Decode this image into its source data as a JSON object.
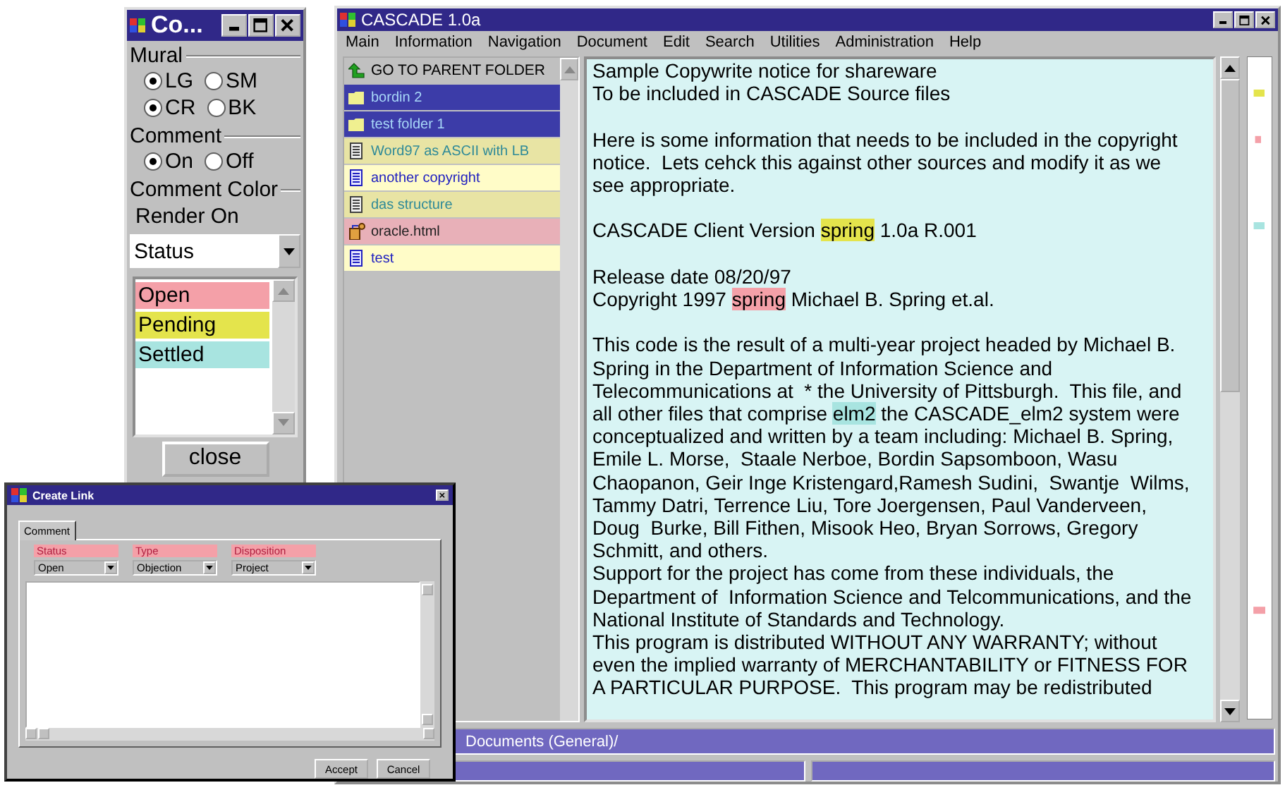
{
  "settings_window": {
    "title": "Co...",
    "mural": {
      "label": "Mural",
      "rows": [
        [
          {
            "label": "LG",
            "selected": true
          },
          {
            "label": "SM",
            "selected": false
          }
        ],
        [
          {
            "label": "CR",
            "selected": true
          },
          {
            "label": "BK",
            "selected": false
          }
        ]
      ]
    },
    "comment": {
      "label": "Comment",
      "options": [
        {
          "label": "On",
          "selected": true
        },
        {
          "label": "Off",
          "selected": false
        }
      ]
    },
    "comment_color_label": "Comment Color",
    "render_on": {
      "label": "Render On",
      "value": "Status"
    },
    "legend": [
      {
        "label": "Open",
        "color": "#f4a0a8"
      },
      {
        "label": "Pending",
        "color": "#e4e44c"
      },
      {
        "label": "Settled",
        "color": "#a8e4e0"
      }
    ],
    "close_button": "close"
  },
  "main_window": {
    "title": "CASCADE 1.0a",
    "menu": [
      "Main",
      "Information",
      "Navigation",
      "Document",
      "Edit",
      "Search",
      "Utilities",
      "Administration",
      "Help"
    ],
    "folder_pane": {
      "parent_link": "GO TO PARENT FOLDER",
      "items": [
        {
          "name": "bordin 2",
          "kind": "folder",
          "color": "#3c3ca8"
        },
        {
          "name": "test folder 1",
          "kind": "folder",
          "color": "#3c3ca8"
        },
        {
          "name": "Word97 as ASCII with LB",
          "kind": "text-file",
          "color": "#e8e4a4"
        },
        {
          "name": "another copyright",
          "kind": "doc-file",
          "color": "#fffcc8"
        },
        {
          "name": "das structure",
          "kind": "text-file",
          "color": "#e8e4a4"
        },
        {
          "name": "oracle.html",
          "kind": "web-file",
          "color": "#e8b0b8"
        },
        {
          "name": "test",
          "kind": "doc-file",
          "color": "#fffcc8"
        }
      ]
    },
    "document": {
      "paragraphs": [
        {
          "segments": [
            {
              "text": "Sample Copywrite notice for shareware\nTo be included in CASCADE Source files"
            }
          ]
        },
        {
          "segments": [
            {
              "text": "Here is some information that needs to be included in the copyright\nnotice.  Lets cehck this against other sources and modify it as we\nsee appropriate."
            }
          ]
        },
        {
          "segments": [
            {
              "text": "CASCADE Client Version "
            },
            {
              "text": "spring",
              "color": "#e4e44c"
            },
            {
              "text": " 1.0a R.001"
            }
          ]
        },
        {
          "segments": [
            {
              "text": "Release date 08/20/97\nCopyright 1997 "
            },
            {
              "text": "spring",
              "color": "#f4a0a8"
            },
            {
              "text": " Michael B. Spring et.al."
            }
          ]
        },
        {
          "segments": [
            {
              "text": "This code is the result of a multi-year project headed by Michael B.\nSpring in the Department of Information Science and\nTelecommunications at  * the University of Pittsburgh.  This file, and\nall other files that comprise "
            },
            {
              "text": "elm2",
              "color": "#a8e4e0"
            },
            {
              "text": " the CASCADE_elm2 system were\nconceptualized and written by a team including: Michael B. Spring,\nEmile L. Morse,  Staale Nerboe, Bordin Sapsomboon, Wasu\nChaopanon, Geir Inge Kristengard,Ramesh Sudini,  Swantje  Wilms,\nTammy Datri, Terrence Liu, Tore Joergensen, Paul Vanderveen,\nDoug  Burke, Bill Fithen, Misook Heo, Bryan Sorrows, Gregory\nSchmitt, and others.\nSupport for the project has come from these individuals, the\nDepartment of  Information Science and Telcommunications, and the\nNational Institute of Standards and Technology.\nThis program is distributed WITHOUT ANY WARRANTY; without\neven the implied warranty of MERCHANTABILITY or FITNESS FOR\nA PARTICULAR PURPOSE.  This program may be redistributed"
            }
          ]
        }
      ]
    },
    "status_bar": "Documents (General)/"
  },
  "create_link": {
    "title": "Create Link",
    "tabs": [
      {
        "label": "Comment",
        "selected": true
      }
    ],
    "fields": [
      {
        "label": "Status",
        "value": "Open"
      },
      {
        "label": "Type",
        "value": "Objection"
      },
      {
        "label": "Disposition",
        "value": "Project"
      }
    ],
    "buttons": [
      "Accept",
      "Cancel"
    ]
  }
}
